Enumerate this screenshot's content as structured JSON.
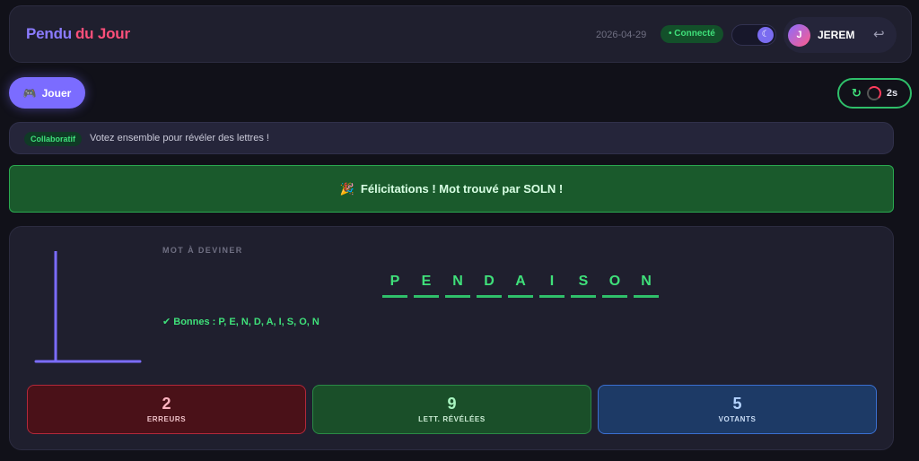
{
  "header": {
    "brand_part1": "Pendu",
    "brand_part2": "du Jour",
    "date": "2026-04-29",
    "status": "• Connecté",
    "theme_toggle_icon": "moon-icon",
    "user": {
      "initial": "J",
      "name": "JEREM",
      "logout_icon": "↩"
    }
  },
  "toolbar": {
    "play_icon": "🎮",
    "play_label": "Jouer",
    "timer_label": "2s",
    "refresh_icon": "↻"
  },
  "collab": {
    "badge": "Collaboratif",
    "text": "Votez ensemble pour révéler des lettres !"
  },
  "success": {
    "icon": "🎉",
    "message": "Félicitations ! Mot trouvé par SOLN !"
  },
  "game": {
    "word_label": "MOT À DEVINER",
    "letters": [
      "P",
      "E",
      "N",
      "D",
      "A",
      "I",
      "S",
      "O",
      "N"
    ],
    "good_letters": "✔ Bonnes : P, E, N, D, A, I, S, O, N",
    "stats": {
      "errors": {
        "value": "2",
        "label": "ERREURS"
      },
      "revealed": {
        "value": "9",
        "label": "LETT. RÉVÉLÉES"
      },
      "voters": {
        "value": "5",
        "label": "VOTANTS"
      }
    }
  },
  "colors": {
    "accent": "#7b6cff",
    "success": "#3fe07a",
    "danger": "#ff3b5c",
    "background": "#111119"
  }
}
